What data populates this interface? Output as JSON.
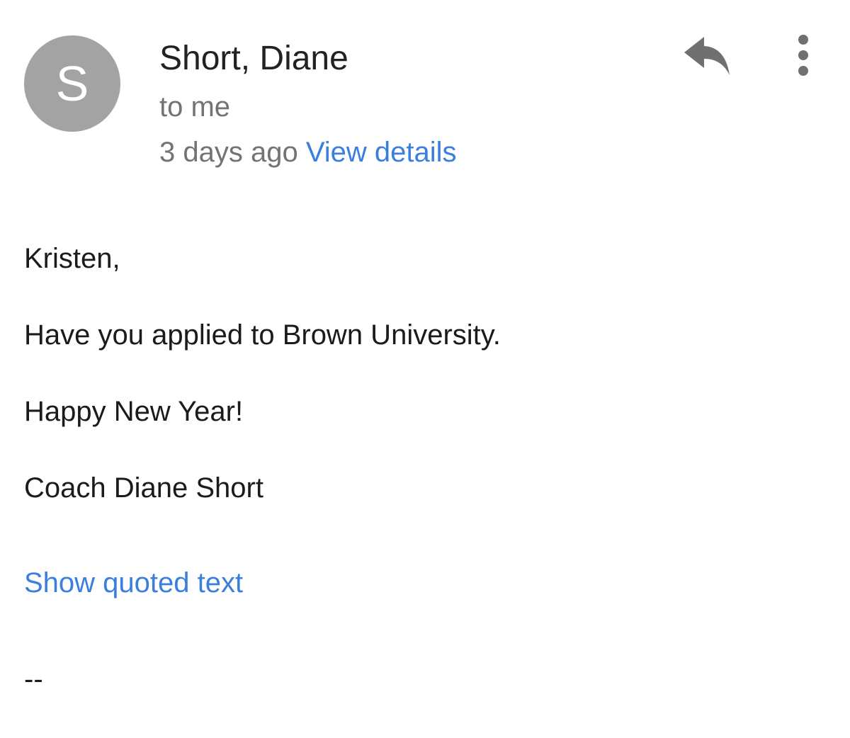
{
  "header": {
    "avatar_letter": "S",
    "avatar_color": "#a3a3a3",
    "sender_name": "Short, Diane",
    "recipient": "to me",
    "timestamp": "3 days ago",
    "view_details_label": "View details",
    "reply_icon": "reply-icon",
    "more_icon": "more-vert-icon"
  },
  "body": {
    "greeting": "Kristen,",
    "line1": "Have you applied to Brown University.",
    "line2": "Happy New Year!",
    "line3": "Coach Diane Short"
  },
  "footer": {
    "show_quoted_label": "Show quoted text",
    "signature_separator": "--"
  },
  "colors": {
    "link": "#3a7fde",
    "secondary_text": "#737373",
    "icon": "#707070"
  }
}
